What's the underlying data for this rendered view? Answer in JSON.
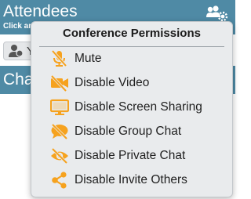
{
  "panel": {
    "title": "Attendees",
    "subtitle": "Click an",
    "user_button_text": "Y",
    "chat_title": "Cha"
  },
  "menu": {
    "header": "Conference Permissions",
    "items": [
      {
        "label": "Mute",
        "icon": "microphone-muted-icon"
      },
      {
        "label": "Disable Video",
        "icon": "video-disabled-icon"
      },
      {
        "label": "Disable Screen Sharing",
        "icon": "monitor-icon"
      },
      {
        "label": "Disable Group Chat",
        "icon": "chat-disabled-icon"
      },
      {
        "label": "Disable Private Chat",
        "icon": "eye-slash-icon"
      },
      {
        "label": "Disable Invite Others",
        "icon": "share-icon"
      }
    ]
  },
  "colors": {
    "header_bg": "#4f8aa5",
    "menu_bg": "#e9ebed",
    "icon_orange": "#f6a21e"
  }
}
